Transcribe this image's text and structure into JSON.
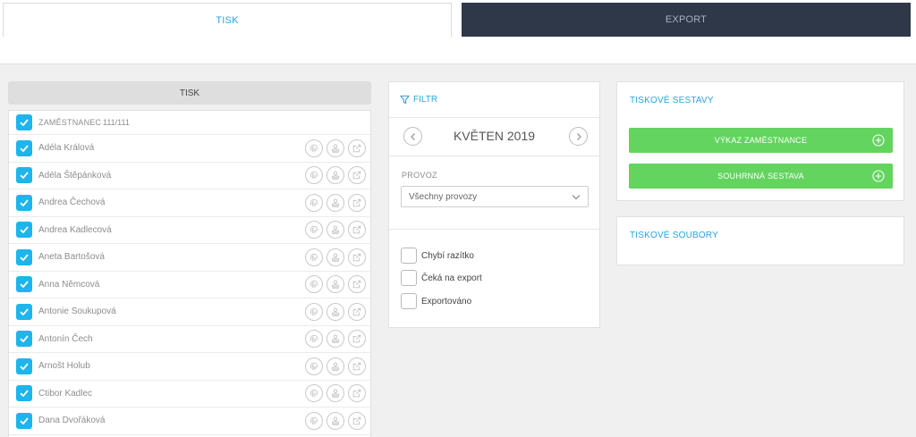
{
  "tabs": {
    "print": "TISK",
    "export": "EXPORT"
  },
  "left": {
    "header": "TISK",
    "column_label": "ZAMĚSTNANEC",
    "count": "111/111",
    "employees": [
      "Adéla Králová",
      "Adéla Štěpánková",
      "Andrea Čechová",
      "Andrea Kadlecová",
      "Aneta Bartošová",
      "Anna Němcová",
      "Antonie Soukupová",
      "Antonín Čech",
      "Arnošt Holub",
      "Ctibor Kadlec",
      "Dana Dvořáková"
    ],
    "row_icons": [
      "fingerprint-icon",
      "stamp-icon",
      "export-icon"
    ]
  },
  "filter": {
    "title": "FILTR",
    "month": "KVĚTEN 2019",
    "provoz_label": "PROVOZ",
    "provoz_value": "Všechny provozy",
    "options": [
      "Chybí razítko",
      "Čeká na export",
      "Exportováno"
    ]
  },
  "reports": {
    "title": "TISKOVÉ SESTAVY",
    "buttons": [
      "VÝKAZ ZAMĚSTNANCE",
      "SOUHRNNÁ SESTAVA"
    ]
  },
  "files": {
    "title": "TISKOVÉ SOUBORY"
  },
  "colors": {
    "accent": "#2aa3e0",
    "checkbox": "#1db5ec",
    "green": "#62d45f",
    "dark_tab": "#2f3848"
  }
}
